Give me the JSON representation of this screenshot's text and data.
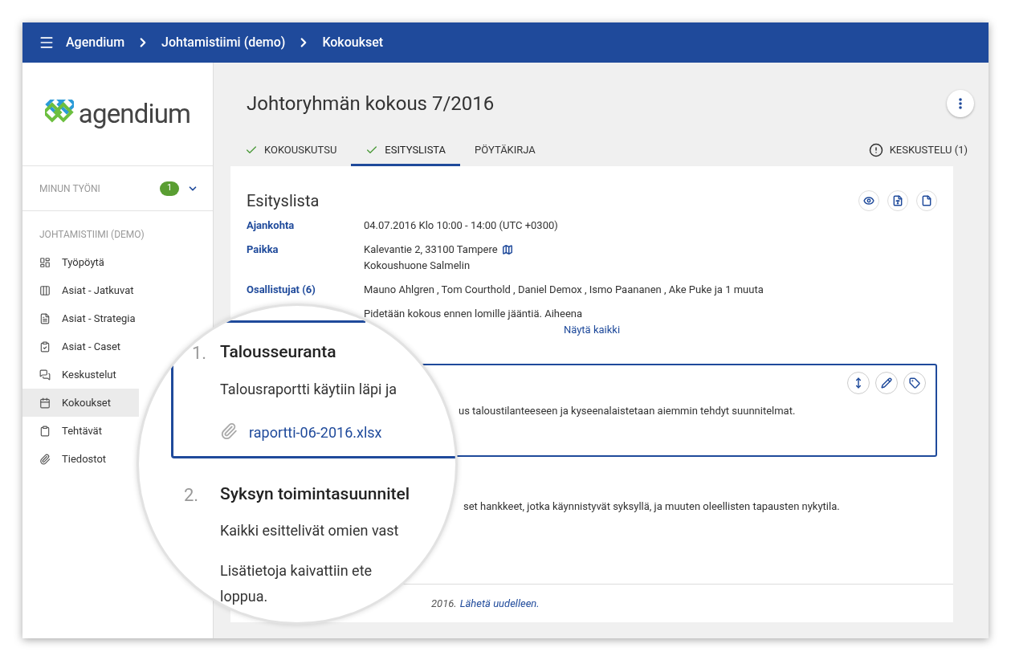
{
  "top_bar": {
    "breadcrumbs": [
      "Agendium",
      "Johtamistiimi (demo)",
      "Kokoukset"
    ]
  },
  "sidebar": {
    "logo_text": "agendium",
    "my_work": {
      "label": "MINUN TYÖNI",
      "count": "1"
    },
    "section_title": "JOHTAMISTIIMI (DEMO)",
    "items": [
      {
        "label": "Työpöytä",
        "selected": false
      },
      {
        "label": "Asiat - Jatkuvat",
        "selected": false
      },
      {
        "label": "Asiat - Strategia",
        "selected": false
      },
      {
        "label": "Asiat - Caset",
        "selected": false
      },
      {
        "label": "Keskustelut",
        "selected": false
      },
      {
        "label": "Kokoukset",
        "selected": true
      },
      {
        "label": "Tehtävät",
        "selected": false
      },
      {
        "label": "Tiedostot",
        "selected": false
      }
    ]
  },
  "page": {
    "title": "Johtoryhmän kokous 7/2016",
    "tabs": [
      {
        "label": "KOKOUSKUTSU",
        "done": true,
        "selected": false
      },
      {
        "label": "ESITYSLISTA",
        "done": true,
        "selected": true
      },
      {
        "label": "PÖYTÄKIRJA",
        "done": false,
        "selected": false
      }
    ],
    "discussion_tab": "KESKUSTELU (1)"
  },
  "agenda": {
    "title": "Esityslista",
    "details": [
      {
        "label": "Ajankohta",
        "lines": [
          "04.07.2016 Klo 10:00 - 14:00 (UTC +0300)"
        ],
        "map": false
      },
      {
        "label": "Paikka",
        "lines": [
          "Kalevantie 2, 33100 Tampere",
          "Kokoushuone Salmelin"
        ],
        "map": true
      },
      {
        "label": "Osallistujat (6)",
        "lines": [
          "Mauno Ahlgren , Tom Courthold , Daniel Demox , Ismo Paananen , Ake Puke ja 1 muuta"
        ],
        "map": false
      }
    ],
    "partial_line": "Pidetään kokous ennen lomille jääntiä. Aiheena",
    "show_all": "Näytä kaikki",
    "item_1_text": "us taloustilanteeseen ja kyseenalaistetaan aiemmin tehdyt suunnitelmat.",
    "item_2_text": "set hankkeet, jotka käynnistyvät syksyllä, ja muuten oleellisten tapausten nykytila.",
    "footer": {
      "text": "2016.",
      "link": "Lähetä uudelleen."
    }
  },
  "magnifier": {
    "items": [
      {
        "number": "1.",
        "title": "Talousseuranta",
        "lines": [
          "Talousraportti käytiin läpi ja"
        ],
        "attachment": "raportti-06-2016.xlsx"
      },
      {
        "number": "2.",
        "title": "Syksyn toimintasuunnitel",
        "lines": [
          "Kaikki esittelivät omien vast",
          "Lisätietoja kaivattiin ete",
          "loppua."
        ]
      }
    ]
  }
}
